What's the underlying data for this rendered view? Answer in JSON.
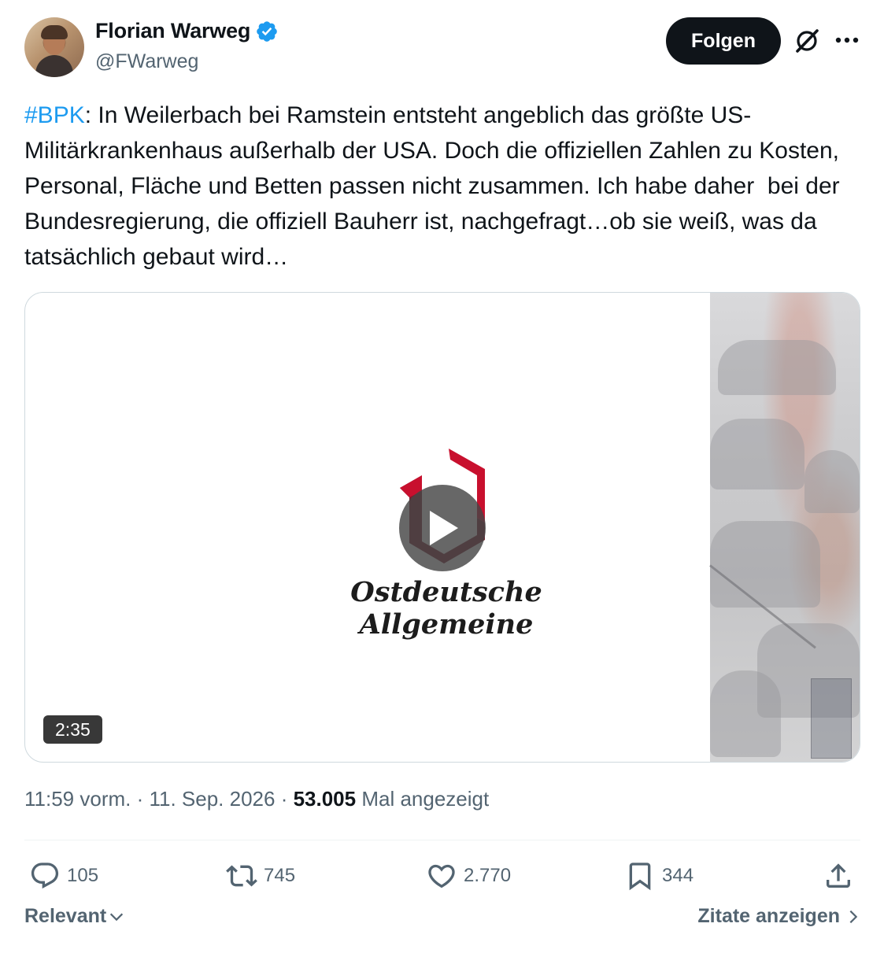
{
  "author": {
    "display_name": "Florian Warweg",
    "handle": "@FWarweg",
    "verified": true
  },
  "header": {
    "follow_label": "Folgen",
    "grok_icon": "grok-icon",
    "more_icon": "more-icon"
  },
  "tweet": {
    "hashtag": "#BPK",
    "text": ": In Weilerbach bei Ramstein entsteht angeblich das größte US-Militärkrankenhaus außerhalb der USA. Doch die offiziellen Zahlen zu Kosten, Personal, Fläche und Betten passen nicht zusammen. Ich habe daher  bei der Bundesregierung, die offiziell Bauherr ist, nachgefragt…ob sie weiß, was da tatsächlich gebaut wird…"
  },
  "media": {
    "logo_text": "Ostdeutsche Allgemeine",
    "duration": "2:35",
    "play_icon": "play-icon"
  },
  "meta": {
    "time": "11:59 vorm.",
    "separator": " · ",
    "date": "11. Sep. 2026",
    "views": "53.005",
    "views_label": "Mal angezeigt"
  },
  "actions": {
    "replies": "105",
    "reposts": "745",
    "likes": "2.770",
    "bookmarks": "344"
  },
  "footer": {
    "sort_label": "Relevant",
    "quotes_label": "Zitate anzeigen"
  },
  "colors": {
    "accent": "#1d9bf0",
    "text": "#0f1419",
    "muted": "#536471",
    "logo_red": "#c8102e",
    "logo_dark_red": "#7b1e2e"
  }
}
